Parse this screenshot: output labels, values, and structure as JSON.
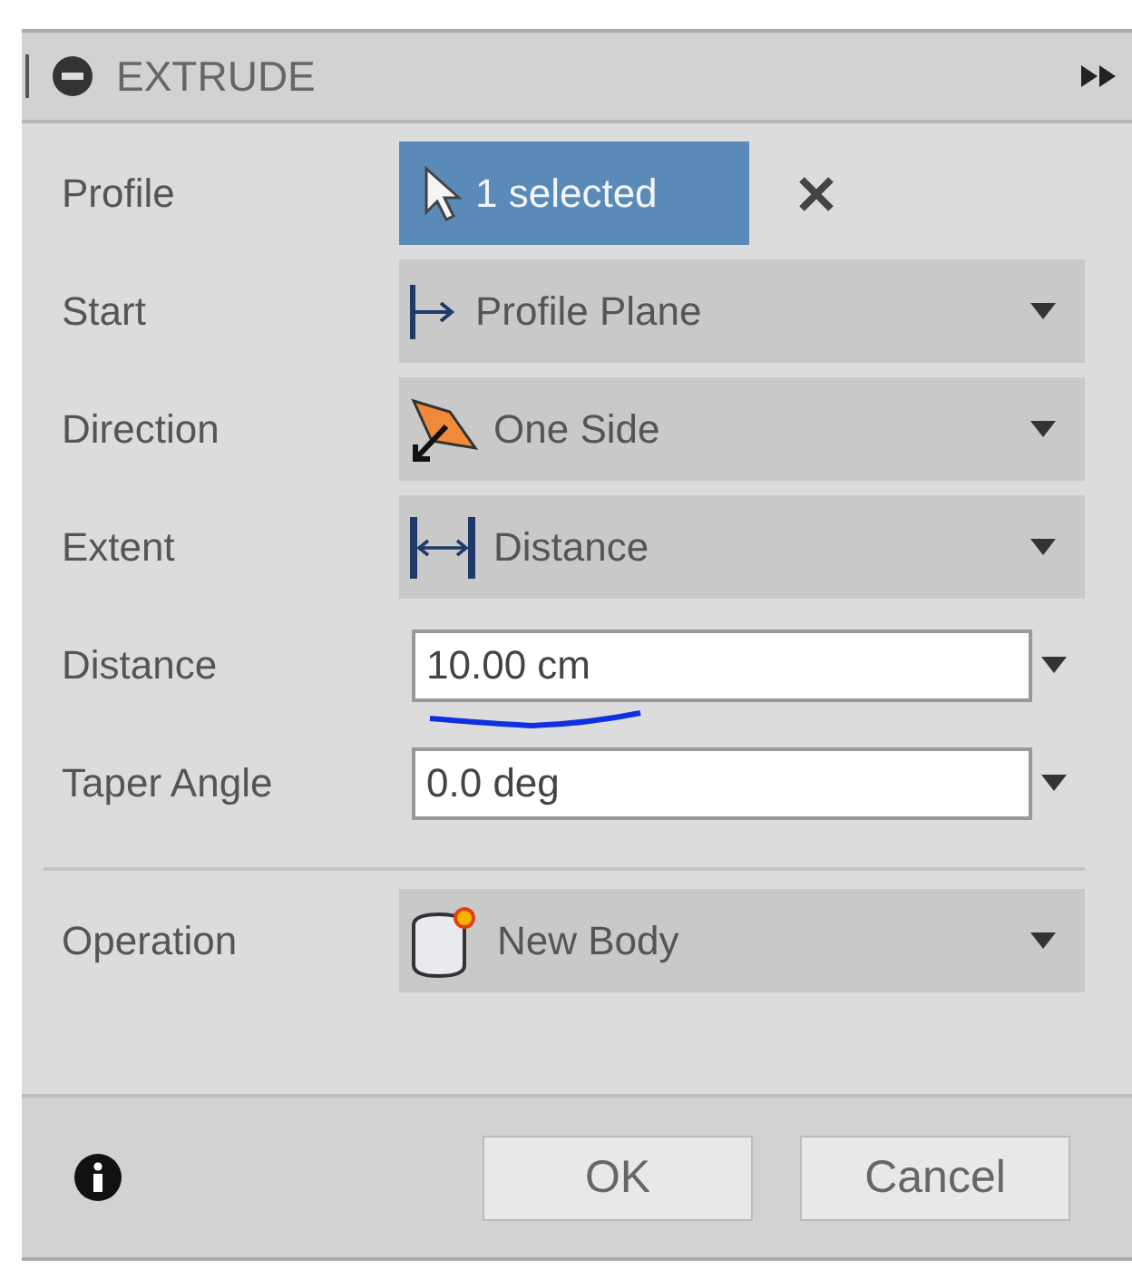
{
  "panel": {
    "title": "EXTRUDE"
  },
  "rows": [
    {
      "kind": "selection",
      "label": "Profile",
      "value": "1 selected"
    },
    {
      "kind": "dropdown",
      "label": "Start",
      "value": "Profile Plane"
    },
    {
      "kind": "dropdown",
      "label": "Direction",
      "value": "One Side"
    },
    {
      "kind": "dropdown",
      "label": "Extent",
      "value": "Distance"
    },
    {
      "kind": "input",
      "label": "Distance",
      "value": "10.00 cm"
    },
    {
      "kind": "input",
      "label": "Taper Angle",
      "value": "0.0 deg"
    },
    {
      "kind": "separator"
    },
    {
      "kind": "dropdown",
      "label": "Operation",
      "value": "New Body"
    }
  ],
  "buttons": [
    "OK",
    "Cancel"
  ]
}
